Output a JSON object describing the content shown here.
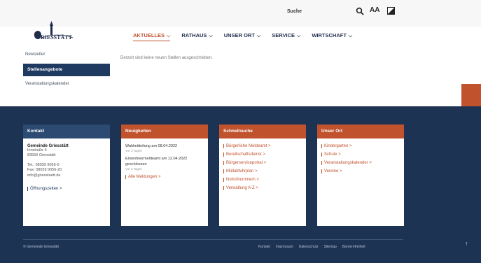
{
  "header": {
    "search_label": "Suche",
    "font_size_label": "AA",
    "nav": [
      {
        "label": "AKTUELLES",
        "active": true
      },
      {
        "label": "RATHAUS",
        "active": false
      },
      {
        "label": "UNSER ORT",
        "active": false
      },
      {
        "label": "SERVICE",
        "active": false
      },
      {
        "label": "WIRTSCHAFT",
        "active": false
      }
    ],
    "chevron": "⌵"
  },
  "side": {
    "item_top": "Newsletter",
    "item_active": "Stellenangebote",
    "item_bottom": "Veranstaltungskalender"
  },
  "main": {
    "text": "Derzeit sind keine neuen Stellen ausgeschrieben."
  },
  "footer": {
    "contact": {
      "title": "Kontakt",
      "name": "Gemeinde Griesstätt",
      "street": "Innstraße 4",
      "city": "83556 Griesstätt",
      "phone": "Tel.: 08039 9056-0",
      "fax": "Fax: 08039 9056-20",
      "email": "info@griesstaett.de",
      "hours": "Öffnungszeiten >"
    },
    "news": {
      "title": "Neuigkeiten",
      "item1_title": "Wahlmitteilung am 08.04.2022",
      "item1_meta": "Vor 3 Tagen",
      "item2_title": "Einwohnermeldeamt am 12.04.2022 geschlossen",
      "item2_meta": "Vor 3 Tagen",
      "more": "Alle Meldungen >"
    },
    "quick": {
      "title": "Schnellsuche",
      "links": [
        "Bürgerliche Meldeamt >",
        "Bereitschaftsdienst >",
        "Bürgerserviceportal >",
        "Müllabfuhrplan >",
        "Notrufnummern >",
        "Verwaltung A-Z >"
      ]
    },
    "ort": {
      "title": "Unser Ort",
      "links": [
        "Kindergarten >",
        "Schule >",
        "Veranstaltungskalender >",
        "Vereine >"
      ]
    },
    "copyright": "© Gemeinde Griesstätt",
    "bottom_links": [
      "Kontakt",
      "Impressum",
      "Datenschutz",
      "Sitemap",
      "Barrierefreiheit"
    ],
    "up": "↑"
  },
  "colors": {
    "accent": "#c0522d",
    "navy": "#1d3354"
  }
}
